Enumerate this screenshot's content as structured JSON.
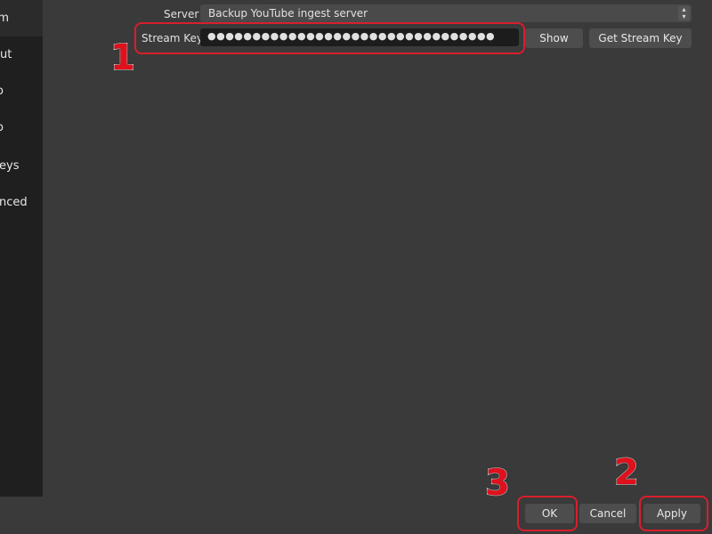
{
  "sidebar": {
    "items": [
      {
        "label": "m",
        "selected": true
      },
      {
        "label": "ut"
      },
      {
        "label": "o"
      },
      {
        "label": "o"
      },
      {
        "label": "eys"
      },
      {
        "label": "nced"
      }
    ]
  },
  "stream": {
    "server_label": "Server",
    "server_value": "Backup YouTube ingest server",
    "key_label": "Stream Key",
    "key_value": "●●●●●●●●●●●●●●●●●●●●●●●●●●●●●●●●",
    "show_button": "Show",
    "get_key_button": "Get Stream Key"
  },
  "footer": {
    "ok": "OK",
    "cancel": "Cancel",
    "apply": "Apply"
  },
  "annotations": {
    "step1": "1",
    "step2": "2",
    "step3": "3",
    "color": "#d81e2c"
  }
}
